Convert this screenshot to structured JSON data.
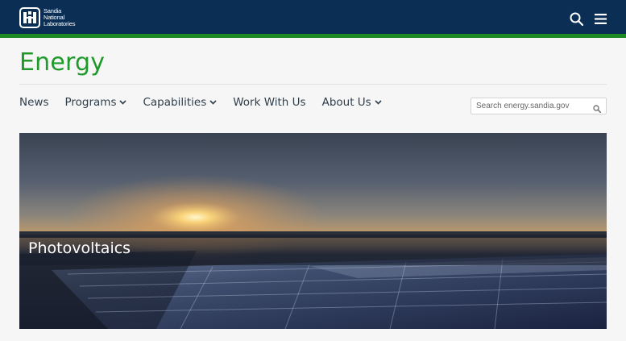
{
  "header": {
    "logo_lines": [
      "Sandia",
      "National",
      "Laboratories"
    ]
  },
  "site": {
    "title": "Energy"
  },
  "nav": {
    "items": [
      {
        "label": "News",
        "dropdown": false
      },
      {
        "label": "Programs",
        "dropdown": true
      },
      {
        "label": "Capabilities",
        "dropdown": true
      },
      {
        "label": "Work With Us",
        "dropdown": false
      },
      {
        "label": "About Us",
        "dropdown": true
      }
    ]
  },
  "search": {
    "placeholder": "Search energy.sandia.gov"
  },
  "hero": {
    "caption": "Photovoltaics"
  },
  "colors": {
    "topbar": "#0b2f54",
    "accent_green": "#1f9a2a",
    "nav_text": "#2f3e4c"
  }
}
